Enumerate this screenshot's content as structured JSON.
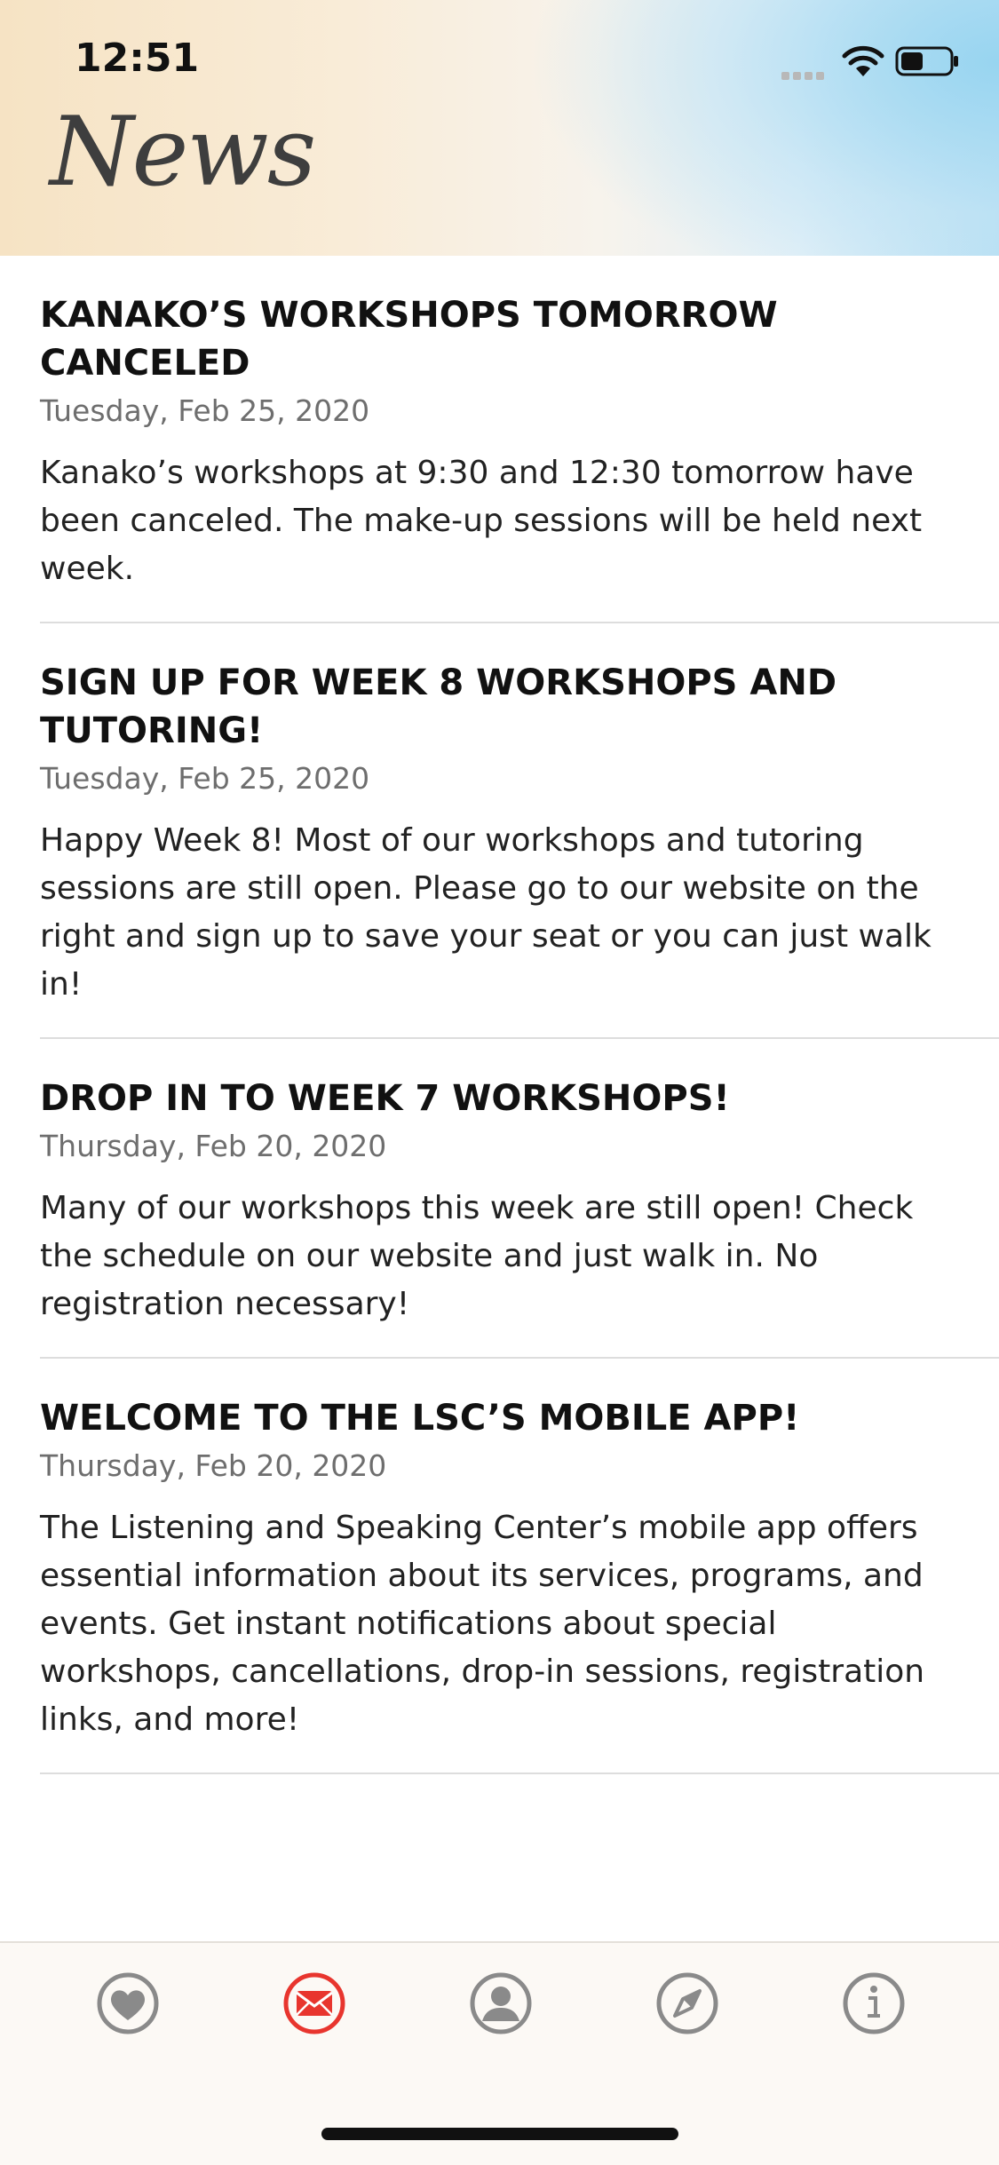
{
  "status_bar": {
    "time": "12:51"
  },
  "header": {
    "title": "News"
  },
  "news": [
    {
      "title": "KANAKO’S WORKSHOPS TOMORROW CANCELED",
      "date": "Tuesday, Feb 25, 2020",
      "body": "Kanako’s workshops at 9:30 and 12:30 tomorrow have been canceled. The make-up sessions will be held next week."
    },
    {
      "title": "SIGN UP FOR WEEK 8 WORKSHOPS AND TUTORING!",
      "date": "Tuesday, Feb 25, 2020",
      "body": "Happy Week 8! Most of our workshops and tutoring sessions are still open. Please go to our website on the right and sign up to save your seat or you can just walk in!"
    },
    {
      "title": "DROP IN TO WEEK 7 WORKSHOPS!",
      "date": "Thursday, Feb 20, 2020",
      "body": "Many of our workshops this week are still open! Check the schedule on our website and just walk in. No registration necessary!"
    },
    {
      "title": "WELCOME TO THE LSC’S MOBILE APP!",
      "date": "Thursday, Feb 20, 2020",
      "body": "The Listening and Speaking Center’s mobile app offers essential information about its services, programs, and events. Get instant notifications about special workshops, cancellations, drop-in sessions, registration links, and more!"
    }
  ],
  "tabbar": {
    "tabs": [
      {
        "icon": "heart-icon",
        "active": false
      },
      {
        "icon": "mail-icon",
        "active": true
      },
      {
        "icon": "person-icon",
        "active": false
      },
      {
        "icon": "compass-icon",
        "active": false
      },
      {
        "icon": "info-icon",
        "active": false
      }
    ],
    "active_color": "#e8352e",
    "inactive_color": "#8a8a8a"
  }
}
